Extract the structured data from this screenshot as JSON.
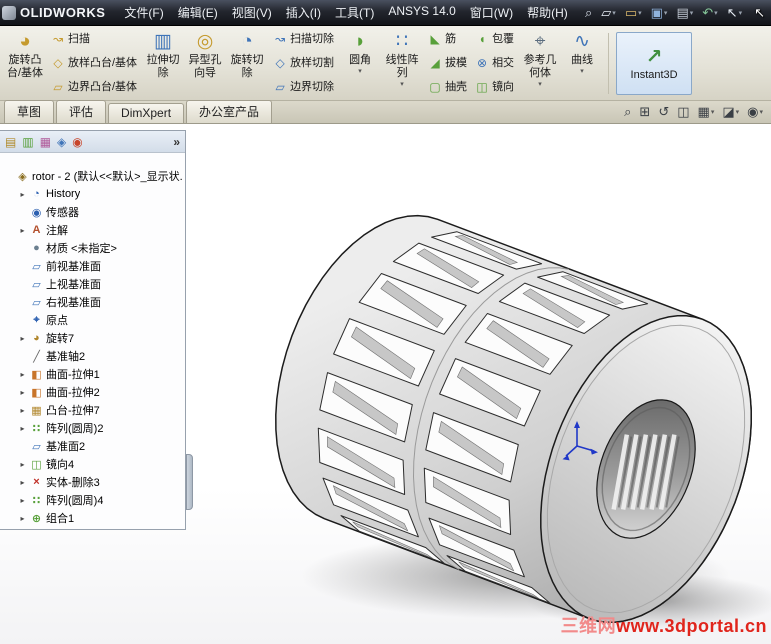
{
  "window": {
    "logo_text": "OLIDWORKS",
    "cursor_glyph": "↖"
  },
  "menu_bar": {
    "items": [
      {
        "label": "文件(F)",
        "name": "menu-file"
      },
      {
        "label": "编辑(E)",
        "name": "menu-edit"
      },
      {
        "label": "视图(V)",
        "name": "menu-view"
      },
      {
        "label": "插入(I)",
        "name": "menu-insert"
      },
      {
        "label": "工具(T)",
        "name": "menu-tools"
      },
      {
        "label": "ANSYS 14.0",
        "name": "menu-ansys"
      },
      {
        "label": "窗口(W)",
        "name": "menu-window"
      },
      {
        "label": "帮助(H)",
        "name": "menu-help"
      }
    ]
  },
  "quick_toolbar": {
    "icons": [
      {
        "name": "search-icon",
        "glyph": "⌕",
        "color": "#d8dee8",
        "caret": ""
      },
      {
        "name": "new-document-icon",
        "glyph": "▱",
        "color": "#e8eef5",
        "caret": "▾"
      },
      {
        "name": "open-icon",
        "glyph": "▭",
        "color": "#d8b76a",
        "caret": "▾"
      },
      {
        "name": "save-icon",
        "glyph": "▣",
        "color": "#8fb3dd",
        "caret": "▾"
      },
      {
        "name": "print-icon",
        "glyph": "▤",
        "color": "#c3cad4",
        "caret": "▾"
      },
      {
        "name": "undo-icon",
        "glyph": "↶",
        "color": "#86c79a",
        "caret": "▾"
      },
      {
        "name": "select-icon",
        "glyph": "↖",
        "color": "#e8eef5",
        "caret": "▾"
      }
    ]
  },
  "ribbon": {
    "group1": [
      {
        "name": "revolved-boss-base-button",
        "icon_name": "revolve-icon",
        "icon": "◕",
        "color": "#c59a2d",
        "l1": "旋转凸",
        "l2": "台/基体",
        "caret": ""
      }
    ],
    "column_a": [
      {
        "name": "swept-boss-base-button",
        "icon_name": "sweep-icon",
        "icon": "↝",
        "color": "#c59a2d",
        "label": "扫描"
      },
      {
        "name": "lofted-boss-base-button",
        "icon_name": "loft-icon",
        "icon": "◇",
        "color": "#c59a2d",
        "label": "放样凸台/基体"
      },
      {
        "name": "boundary-boss-base-button",
        "icon_name": "boundary-icon",
        "icon": "▱",
        "color": "#c59a2d",
        "label": "边界凸台/基体"
      }
    ],
    "group2": [
      {
        "name": "extruded-cut-button",
        "icon_name": "extruded-cut-icon",
        "icon": "▥",
        "color": "#3f74b8",
        "l1": "拉伸切",
        "l2": "除",
        "caret": ""
      },
      {
        "name": "hole-wizard-button",
        "icon_name": "hole-wizard-icon",
        "icon": "◎",
        "color": "#c59a2d",
        "l1": "异型孔",
        "l2": "向导",
        "caret": ""
      },
      {
        "name": "revolved-cut-button",
        "icon_name": "revolved-cut-icon",
        "icon": "◔",
        "color": "#3f74b8",
        "l1": "旋转切",
        "l2": "除",
        "caret": ""
      }
    ],
    "column_b": [
      {
        "name": "swept-cut-button",
        "icon_name": "swept-cut-icon",
        "icon": "↝",
        "color": "#3f74b8",
        "label": "扫描切除"
      },
      {
        "name": "lofted-cut-button",
        "icon_name": "lofted-cut-icon",
        "icon": "◇",
        "color": "#3f74b8",
        "label": "放样切割"
      },
      {
        "name": "boundary-cut-button",
        "icon_name": "boundary-cut-icon",
        "icon": "▱",
        "color": "#3f74b8",
        "label": "边界切除"
      }
    ],
    "group3": [
      {
        "name": "fillet-button",
        "icon_name": "fillet-icon",
        "icon": "◗",
        "color": "#58a03a",
        "l1": "圆角",
        "l2": "",
        "caret": "▾"
      },
      {
        "name": "linear-pattern-button",
        "icon_name": "linear-pattern-icon",
        "icon": "∷",
        "color": "#3f74b8",
        "l1": "线性阵",
        "l2": "列",
        "caret": "▾"
      }
    ],
    "column_c": [
      {
        "name": "rib-button",
        "icon_name": "rib-icon",
        "icon": "◣",
        "color": "#58a03a",
        "label": "筋"
      },
      {
        "name": "draft-button",
        "icon_name": "draft-icon",
        "icon": "◢",
        "color": "#58a03a",
        "label": "拔模"
      },
      {
        "name": "shell-button",
        "icon_name": "shell-icon",
        "icon": "▢",
        "color": "#58a03a",
        "label": "抽壳"
      }
    ],
    "column_d": [
      {
        "name": "wrap-button",
        "icon_name": "wrap-icon",
        "icon": "◖",
        "color": "#58a03a",
        "label": "包覆"
      },
      {
        "name": "intersect-button",
        "icon_name": "intersect-icon",
        "icon": "⊗",
        "color": "#3f74b8",
        "label": "相交"
      },
      {
        "name": "mirror-button",
        "icon_name": "mirror-icon",
        "icon": "◫",
        "color": "#58a03a",
        "label": "镜向"
      }
    ],
    "group4": [
      {
        "name": "reference-geometry-button",
        "icon_name": "reference-geometry-icon",
        "icon": "⌖",
        "color": "#5a6c7e",
        "l1": "参考几",
        "l2": "何体",
        "caret": "▾"
      },
      {
        "name": "curves-button",
        "icon_name": "curves-icon",
        "icon": "∿",
        "color": "#3f74b8",
        "l1": "曲线",
        "l2": "",
        "caret": "▾"
      }
    ],
    "instant3d": {
      "label": "Instant3D",
      "icon": "↗"
    }
  },
  "tab_bar": {
    "tabs": [
      {
        "label": "草图",
        "name": "tab-sketch"
      },
      {
        "label": "评估",
        "name": "tab-evaluate"
      },
      {
        "label": "DimXpert",
        "name": "tab-dimxpert"
      },
      {
        "label": "办公室产品",
        "name": "tab-office-products"
      }
    ],
    "view_icons": [
      {
        "name": "zoom-fit-icon",
        "glyph": "⌕",
        "caret": ""
      },
      {
        "name": "zoom-area-icon",
        "glyph": "⊞",
        "caret": ""
      },
      {
        "name": "previous-view-icon",
        "glyph": "↺",
        "caret": ""
      },
      {
        "name": "section-view-icon",
        "glyph": "◫",
        "caret": ""
      },
      {
        "name": "view-orientation-icon",
        "glyph": "▦",
        "caret": "▾"
      },
      {
        "name": "display-style-icon",
        "glyph": "◪",
        "caret": "▾"
      },
      {
        "name": "hide-show-items-icon",
        "glyph": "◉",
        "caret": "▾"
      }
    ]
  },
  "feature_panel": {
    "header_icons": [
      {
        "name": "featuremanager-tab-icon",
        "glyph": "▤",
        "color": "#b08a2a"
      },
      {
        "name": "propertymanager-tab-icon",
        "glyph": "▥",
        "color": "#58a03a"
      },
      {
        "name": "configurationmanager-tab-icon",
        "glyph": "▦",
        "color": "#b05a9a"
      },
      {
        "name": "dimxpertmanager-tab-icon",
        "glyph": "◈",
        "color": "#3f74b8"
      },
      {
        "name": "displaymanager-tab-icon",
        "glyph": "◉",
        "color": "#c8452a"
      }
    ],
    "overflow_icon": "»",
    "tree": {
      "items": [
        {
          "arrow": "",
          "icon": "◈",
          "icon_color": "#8a6d1f",
          "icon_name": "part-icon",
          "label": "rotor - 2 (默认<<默认>_显示状...",
          "pad": "2px"
        },
        {
          "arrow": "▸",
          "icon": "◔",
          "icon_color": "#2b5fb0",
          "icon_name": "history-folder-icon",
          "label": "History",
          "pad": "16px"
        },
        {
          "arrow": "",
          "icon": "◉",
          "icon_color": "#2b5fb0",
          "icon_name": "sensors-icon",
          "label": "传感器",
          "pad": "16px"
        },
        {
          "arrow": "▸",
          "icon": "A",
          "icon_color": "#b3502d",
          "icon_name": "annotations-icon",
          "label": "注解",
          "pad": "16px"
        },
        {
          "arrow": "",
          "icon": "●",
          "icon_color": "#6b7f8f",
          "icon_name": "material-icon",
          "label": "材质 <未指定>",
          "pad": "16px"
        },
        {
          "arrow": "",
          "icon": "▱",
          "icon_color": "#3f74b8",
          "icon_name": "front-plane-icon",
          "label": "前视基准面",
          "pad": "16px"
        },
        {
          "arrow": "",
          "icon": "▱",
          "icon_color": "#3f74b8",
          "icon_name": "top-plane-icon",
          "label": "上视基准面",
          "pad": "16px"
        },
        {
          "arrow": "",
          "icon": "▱",
          "icon_color": "#3f74b8",
          "icon_name": "right-plane-icon",
          "label": "右视基准面",
          "pad": "16px"
        },
        {
          "arrow": "",
          "icon": "⌖",
          "icon_color": "#2b5fb0",
          "icon_name": "origin-icon",
          "label": "原点",
          "pad": "16px"
        },
        {
          "arrow": "▸",
          "icon": "◕",
          "icon_color": "#b0862c",
          "icon_name": "revolve-feature-icon",
          "label": "旋转7",
          "pad": "16px"
        },
        {
          "arrow": "",
          "icon": "╱",
          "icon_color": "#666666",
          "icon_name": "axis-icon",
          "label": "基准轴2",
          "pad": "16px"
        },
        {
          "arrow": "▸",
          "icon": "◧",
          "icon_color": "#c8742a",
          "icon_name": "surface-extrude-icon",
          "label": "曲面-拉伸1",
          "pad": "16px"
        },
        {
          "arrow": "▸",
          "icon": "◧",
          "icon_color": "#c8742a",
          "icon_name": "surface-extrude-icon",
          "label": "曲面-拉伸2",
          "pad": "16px"
        },
        {
          "arrow": "▸",
          "icon": "▦",
          "icon_color": "#b0862c",
          "icon_name": "boss-extrude-icon",
          "label": "凸台-拉伸7",
          "pad": "16px"
        },
        {
          "arrow": "▸",
          "icon": "∷",
          "icon_color": "#58a03a",
          "icon_name": "circular-pattern-icon",
          "label": "阵列(圆周)2",
          "pad": "16px"
        },
        {
          "arrow": "",
          "icon": "▱",
          "icon_color": "#3f74b8",
          "icon_name": "plane-icon",
          "label": "基准面2",
          "pad": "16px"
        },
        {
          "arrow": "▸",
          "icon": "◫",
          "icon_color": "#58a03a",
          "icon_name": "mirror-feature-icon",
          "label": "镜向4",
          "pad": "16px"
        },
        {
          "arrow": "▸",
          "icon": "×",
          "icon_color": "#c03028",
          "icon_name": "delete-body-icon",
          "label": "实体-删除3",
          "pad": "16px"
        },
        {
          "arrow": "▸",
          "icon": "∷",
          "icon_color": "#58a03a",
          "icon_name": "circular-pattern-icon",
          "label": "阵列(圆周)4",
          "pad": "16px"
        },
        {
          "arrow": "▸",
          "icon": "⊕",
          "icon_color": "#58a03a",
          "icon_name": "combine-icon",
          "label": "组合1",
          "pad": "16px"
        }
      ]
    }
  },
  "viewport": {
    "watermark": {
      "site_name": "三维网",
      "site_url": "www.3dportal.cn",
      "name_color": "#f28a8a",
      "url_color": "#e0251c"
    }
  }
}
